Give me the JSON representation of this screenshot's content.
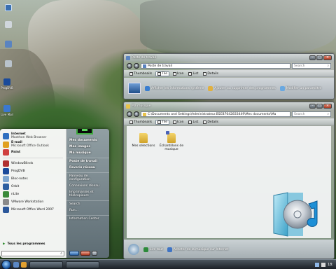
{
  "desktop": {
    "icons": [
      {
        "label": "",
        "color": "#3a6fb0"
      },
      {
        "label": "",
        "color": "#d0d6dc"
      },
      {
        "label": "",
        "color": "#5a84c0"
      },
      {
        "label": "ProgDVB",
        "color": "#1a4a9a"
      },
      {
        "label": "Live Mail",
        "color": "#3b78d0"
      }
    ]
  },
  "window1": {
    "title": "Poste de travail",
    "address": "Poste de travail",
    "search_placeholder": "Search",
    "toolbar": [
      {
        "label": "Thumbnails",
        "icon": "thumbnails-icon"
      },
      {
        "label": "Tile",
        "icon": "tile-icon"
      },
      {
        "label": "Icon",
        "icon": "icon-view-icon"
      },
      {
        "label": "List",
        "icon": "list-icon"
      },
      {
        "label": "Details",
        "icon": "details-icon"
      }
    ],
    "tasks": [
      {
        "label": "Afficher les informations système",
        "icon": "system-info-icon"
      },
      {
        "label": "Ajouter ou supprimer des programmes",
        "icon": "add-remove-programs-icon"
      },
      {
        "label": "Modifier un paramètre",
        "icon": "settings-icon"
      }
    ]
  },
  "window2": {
    "title": "Ma musique",
    "address": "C:\\Documents and Settings\\Administrateur.B5EB7642833449\\Mes documents\\Ma",
    "search_placeholder": "Search",
    "toolbar": [
      {
        "label": "Thumbnails",
        "icon": "thumbnails-icon"
      },
      {
        "label": "Tile",
        "icon": "tile-icon"
      },
      {
        "label": "Icon",
        "icon": "icon-view-icon"
      },
      {
        "label": "List",
        "icon": "list-icon"
      },
      {
        "label": "Details",
        "icon": "details-icon"
      }
    ],
    "files": [
      {
        "label": "Mes sélections",
        "type": "folder"
      },
      {
        "label": "Échantillons de musique",
        "type": "folder"
      }
    ],
    "tasks": [
      {
        "label": "Lire tout",
        "icon": "play-all-icon"
      },
      {
        "label": "Acheter de la musique sur Internet",
        "icon": "shop-music-icon"
      }
    ]
  },
  "start_menu": {
    "pinned": [
      {
        "title": "Internet",
        "subtitle": "Maxthon Web Browser",
        "icon": "browser-icon",
        "color": "#2f6fc0"
      },
      {
        "title": "E-mail",
        "subtitle": "Microsoft Office Outlook",
        "icon": "mail-icon",
        "color": "#e0a020"
      },
      {
        "title": "Paint",
        "subtitle": "",
        "icon": "paint-icon",
        "color": "#d04040"
      }
    ],
    "recent": [
      {
        "label": "WindowBlinds",
        "icon": "windowblinds-icon",
        "color": "#b03030"
      },
      {
        "label": "ProgDVB",
        "icon": "progdvb-icon",
        "color": "#1a4a9a"
      },
      {
        "label": "Bloc-notes",
        "icon": "notepad-icon",
        "color": "#7da6d0"
      },
      {
        "label": "Orbit",
        "icon": "orbit-icon",
        "color": "#2d5fa0"
      },
      {
        "label": "nLite",
        "icon": "nlite-icon",
        "color": "#3a8a3a"
      },
      {
        "label": "VMware Workstation",
        "icon": "vmware-icon",
        "color": "#8a8a8a"
      },
      {
        "label": "Microsoft Office Word 2007",
        "icon": "word-icon",
        "color": "#2b579a"
      }
    ],
    "all_programs": "Tous les programmes",
    "right": [
      {
        "label": "Mes documents",
        "bold": true,
        "sep": false
      },
      {
        "label": "Mes images",
        "bold": true,
        "sep": false
      },
      {
        "label": "Ma musique",
        "bold": true,
        "sep": false
      },
      {
        "label": "Poste de travail",
        "bold": true,
        "sep": true
      },
      {
        "label": "Favoris réseau",
        "bold": true,
        "sep": false
      },
      {
        "label": "Panneau de configuration",
        "bold": false,
        "sep": true
      },
      {
        "label": "Connexions réseau",
        "bold": false,
        "sep": false
      },
      {
        "label": "Imprimantes et télécopieurs",
        "bold": false,
        "sep": false
      },
      {
        "label": "Search",
        "bold": false,
        "sep": true
      },
      {
        "label": "Run...",
        "bold": false,
        "sep": false
      },
      {
        "label": "Information Center",
        "bold": false,
        "sep": true
      }
    ]
  },
  "taskbar": {
    "clock": "18:"
  }
}
